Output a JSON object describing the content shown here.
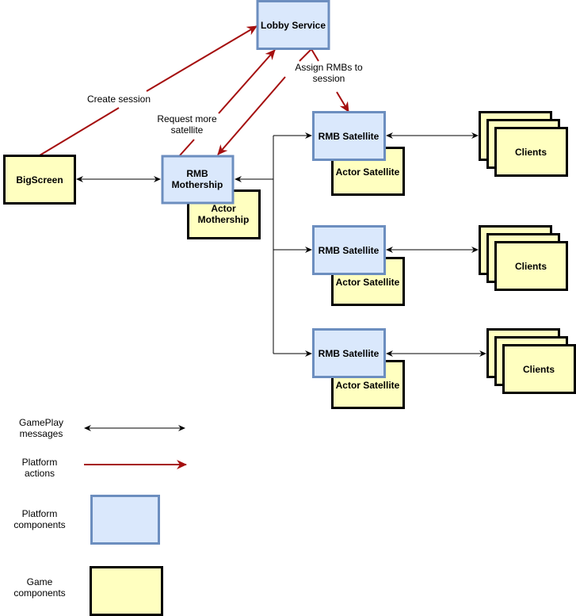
{
  "colors": {
    "platform_fill": "#dae8fc",
    "platform_stroke": "#6c8ebf",
    "game_fill": "#ffffc0",
    "platform_action": "#a50f0f",
    "gameplay_message": "#000000"
  },
  "nodes": {
    "lobby": "Lobby Service",
    "bigscreen": "BigScreen",
    "rmb_mothership": [
      "RMB",
      "Mothership"
    ],
    "actor_mothership": [
      "Actor",
      "Mothership"
    ],
    "satellites": [
      {
        "rmb": "RMB Satellite",
        "actor": "Actor Satellite",
        "clients": "Clients"
      },
      {
        "rmb": "RMB Satellite",
        "actor": "Actor Satellite",
        "clients": "Clients"
      },
      {
        "rmb": "RMB Satellite",
        "actor": "Actor Satellite",
        "clients": "Clients"
      }
    ]
  },
  "edges": {
    "create_session": "Create session",
    "request_more": [
      "Request more",
      "satellite"
    ],
    "assign": [
      "Assign RMBs to",
      "session"
    ]
  },
  "legend": {
    "gameplay": [
      "GamePlay",
      "messages"
    ],
    "platform_actions": [
      "Platform",
      "actions"
    ],
    "platform_components": [
      "Platform",
      "components"
    ],
    "game_components": [
      "Game",
      "components"
    ]
  }
}
